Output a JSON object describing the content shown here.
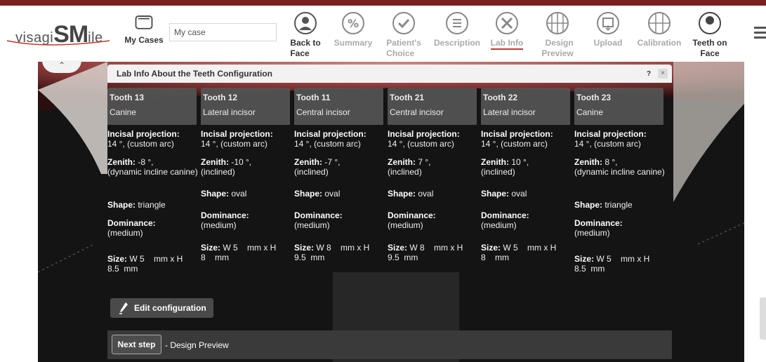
{
  "logo": {
    "pre": "visagi",
    "big": "SM",
    "post": "ile"
  },
  "case_input": {
    "value": "My case"
  },
  "nav": {
    "my_cases": "My Cases",
    "items": [
      {
        "label1": "Back to",
        "label2": "Face",
        "icon": "face-icon"
      },
      {
        "label1": "Summary",
        "label2": "",
        "icon": "percent-icon"
      },
      {
        "label1": "Patient's",
        "label2": "Choice",
        "icon": "check-icon"
      },
      {
        "label1": "Description",
        "label2": "",
        "icon": "list-icon"
      },
      {
        "label1": "Lab Info",
        "label2": "",
        "icon": "tools-icon"
      },
      {
        "label1": "Design",
        "label2": "Preview",
        "icon": "grid-globe-icon"
      },
      {
        "label1": "Upload",
        "label2": "",
        "icon": "upload-icon"
      },
      {
        "label1": "Calibration",
        "label2": "",
        "icon": "calibration-icon"
      },
      {
        "label1": "Teeth on",
        "label2": "Face",
        "icon": "face-smile-icon"
      }
    ]
  },
  "panel": {
    "title": "Lab Info About the Teeth Configuration",
    "help": "?",
    "close": "×"
  },
  "teeth": [
    {
      "num": "Tooth 13",
      "type": "Canine",
      "incisal_label": "Incisal projection:",
      "incisal_val": "14 °, (custom arc)",
      "zenith_label": "Zenith:",
      "zenith_val": " -8    °,",
      "zenith_extra": "(dynamic incline canine)",
      "shape_label": "Shape:",
      "shape_val": " triangle",
      "dom_label": "Dominance:",
      "dom_val": "(medium)",
      "size_label": "Size:",
      "size_val1": " W 5    mm x H",
      "size_val2": "8.5  mm"
    },
    {
      "num": "Tooth 12",
      "type": "Lateral incisor",
      "incisal_label": "Incisal projection:",
      "incisal_val": "14 °, (custom arc)",
      "zenith_label": "Zenith:",
      "zenith_val": " -10  °,",
      "zenith_extra": "(inclined)",
      "shape_label": "Shape:",
      "shape_val": " oval",
      "dom_label": "Dominance:",
      "dom_val": "(medium)",
      "size_label": "Size:",
      "size_val1": " W 5    mm x H",
      "size_val2": "8    mm"
    },
    {
      "num": "Tooth 11",
      "type": "Central incisor",
      "incisal_label": "Incisal projection:",
      "incisal_val": "14 °, (custom arc)",
      "zenith_label": "Zenith:",
      "zenith_val": " -7    °,",
      "zenith_extra": "(inclined)",
      "shape_label": "Shape:",
      "shape_val": " oval",
      "dom_label": "Dominance:",
      "dom_val": "(medium)",
      "size_label": "Size:",
      "size_val1": " W 8    mm x H",
      "size_val2": "9.5  mm"
    },
    {
      "num": "Tooth 21",
      "type": "Central incisor",
      "incisal_label": "Incisal projection:",
      "incisal_val": "14 °, (custom arc)",
      "zenith_label": "Zenith:",
      "zenith_val": " 7     °,",
      "zenith_extra": "(inclined)",
      "shape_label": "Shape:",
      "shape_val": " oval",
      "dom_label": "Dominance:",
      "dom_val": "(medium)",
      "size_label": "Size:",
      "size_val1": " W 8    mm x H",
      "size_val2": "9.5  mm"
    },
    {
      "num": "Tooth 22",
      "type": "Lateral incisor",
      "incisal_label": "Incisal projection:",
      "incisal_val": "14 °, (custom arc)",
      "zenith_label": "Zenith:",
      "zenith_val": " 10    °,",
      "zenith_extra": "(inclined)",
      "shape_label": "Shape:",
      "shape_val": " oval",
      "dom_label": "Dominance:",
      "dom_val": "(medium)",
      "size_label": "Size:",
      "size_val1": " W 5    mm x H",
      "size_val2": "8    mm"
    },
    {
      "num": "Tooth 23",
      "type": "Canine",
      "incisal_label": "Incisal projection:",
      "incisal_val": "14 °, (custom arc)",
      "zenith_label": "Zenith:",
      "zenith_val": " 8     °,",
      "zenith_extra": "(dynamic incline canine)",
      "shape_label": "Shape:",
      "shape_val": " triangle",
      "dom_label": "Dominance:",
      "dom_val": "(medium)",
      "size_label": "Size:",
      "size_val1": " W 5    mm x H",
      "size_val2": "8.5  mm"
    }
  ],
  "edit_button": "Edit configuration",
  "next": {
    "button": "Next step",
    "text": "- Design Preview"
  },
  "colors": {
    "brand": "#7a1f1f",
    "active_underline": "#c0392b"
  }
}
